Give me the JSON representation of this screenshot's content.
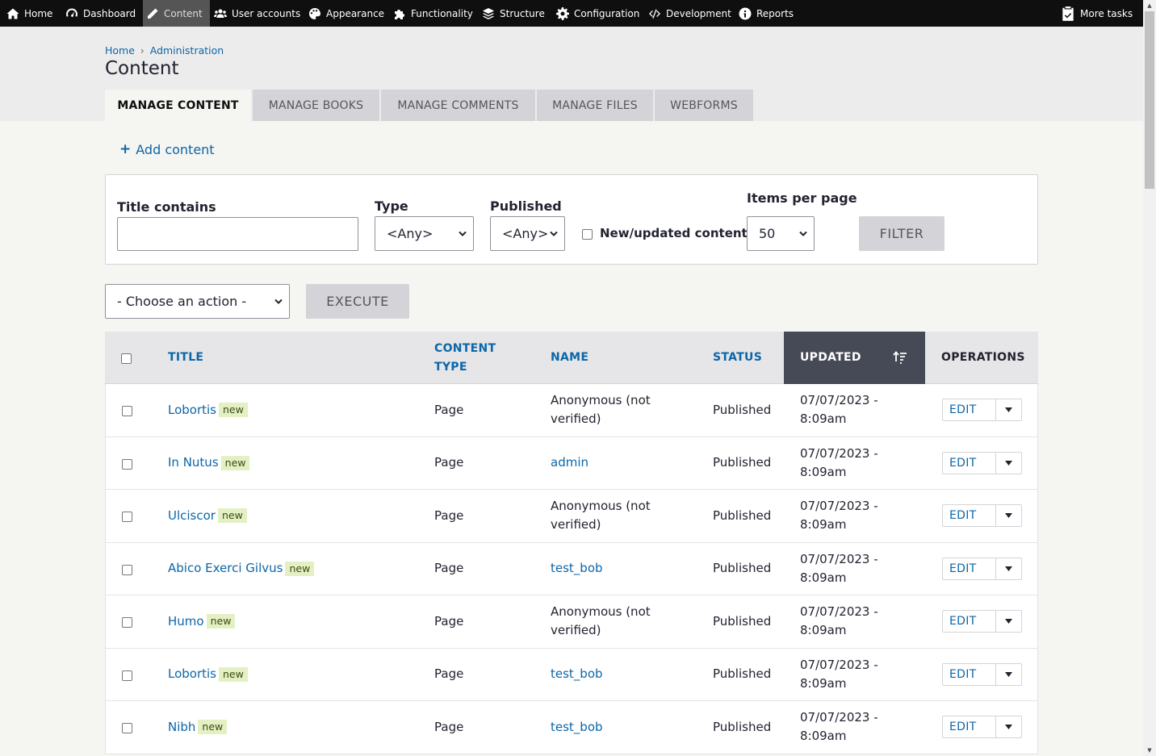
{
  "toolbar": {
    "items": [
      {
        "label": "Home",
        "icon": "home-icon"
      },
      {
        "label": "Dashboard",
        "icon": "dashboard-icon"
      },
      {
        "label": "Content",
        "icon": "pencil-icon",
        "active": true
      },
      {
        "label": "User accounts",
        "icon": "users-icon"
      },
      {
        "label": "Appearance",
        "icon": "palette-icon"
      },
      {
        "label": "Functionality",
        "icon": "puzzle-icon"
      },
      {
        "label": "Structure",
        "icon": "layers-icon"
      },
      {
        "label": "Configuration",
        "icon": "gear-icon"
      },
      {
        "label": "Development",
        "icon": "code-icon"
      },
      {
        "label": "Reports",
        "icon": "info-icon"
      }
    ],
    "more_tasks": {
      "label": "More tasks",
      "icon": "clipboard-check-icon"
    }
  },
  "breadcrumb": {
    "home": "Home",
    "admin": "Administration",
    "separator": "›"
  },
  "page_title": "Content",
  "tabs": [
    "Manage content",
    "Manage books",
    "Manage comments",
    "Manage files",
    "Webforms"
  ],
  "active_tab": "Manage content",
  "add_content": {
    "plus": "+",
    "label": "Add content"
  },
  "filters": {
    "title_label": "Title contains",
    "title_value": "",
    "type_label": "Type",
    "type_value": "<Any>",
    "published_label": "Published",
    "published_value": "<Any>",
    "new_updated_label": "New/updated content",
    "new_updated_checked": false,
    "items_label": "Items per page",
    "items_value": "50",
    "filter_button": "FILTER"
  },
  "bulk": {
    "action_value": "- Choose an action -",
    "execute_button": "EXECUTE"
  },
  "table": {
    "headers": {
      "title": "TITLE",
      "content_type_1": "CONTENT",
      "content_type_2": "TYPE",
      "name": "NAME",
      "status": "STATUS",
      "updated": "UPDATED",
      "operations": "OPERATIONS"
    },
    "rows": [
      {
        "title": "Lobortis",
        "badge": "new",
        "type": "Page",
        "name_1": "Anonymous (not",
        "name_2": "verified)",
        "name_link": false,
        "status": "Published",
        "updated_1": "07/07/2023 -",
        "updated_2": "8:09am",
        "edit": "EDIT"
      },
      {
        "title": "In Nutus",
        "badge": "new",
        "type": "Page",
        "name_1": "admin",
        "name_2": "",
        "name_link": true,
        "status": "Published",
        "updated_1": "07/07/2023 -",
        "updated_2": "8:09am",
        "edit": "EDIT"
      },
      {
        "title": "Ulciscor",
        "badge": "new",
        "type": "Page",
        "name_1": "Anonymous (not",
        "name_2": "verified)",
        "name_link": false,
        "status": "Published",
        "updated_1": "07/07/2023 -",
        "updated_2": "8:09am",
        "edit": "EDIT"
      },
      {
        "title": "Abico Exerci Gilvus",
        "badge": "new",
        "type": "Page",
        "name_1": "test_bob",
        "name_2": "",
        "name_link": true,
        "status": "Published",
        "updated_1": "07/07/2023 -",
        "updated_2": "8:09am",
        "edit": "EDIT"
      },
      {
        "title": "Humo",
        "badge": "new",
        "type": "Page",
        "name_1": "Anonymous (not",
        "name_2": "verified)",
        "name_link": false,
        "status": "Published",
        "updated_1": "07/07/2023 -",
        "updated_2": "8:09am",
        "edit": "EDIT"
      },
      {
        "title": "Lobortis",
        "badge": "new",
        "type": "Page",
        "name_1": "test_bob",
        "name_2": "",
        "name_link": true,
        "status": "Published",
        "updated_1": "07/07/2023 -",
        "updated_2": "8:09am",
        "edit": "EDIT"
      },
      {
        "title": "Nibh",
        "badge": "new",
        "type": "Page",
        "name_1": "test_bob",
        "name_2": "",
        "name_link": true,
        "status": "Published",
        "updated_1": "07/07/2023 -",
        "updated_2": "8:09am",
        "edit": "EDIT"
      }
    ]
  },
  "colors": {
    "link": "#0c66a8",
    "toolbar_bg": "#0f0f0f",
    "badge_bg": "#e4f0c4",
    "sorted_header_bg": "#454a56"
  }
}
